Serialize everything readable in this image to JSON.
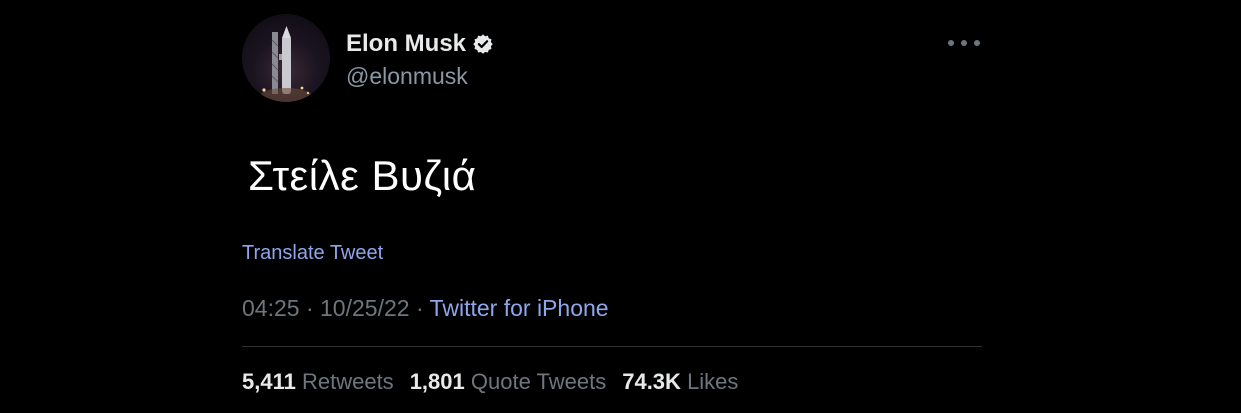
{
  "tweet": {
    "author": {
      "name": "Elon Musk",
      "handle": "@elonmusk",
      "verified_icon": "verified-badge-icon",
      "avatar_icon": "rocket-launchpad-avatar"
    },
    "more_icon": "more-options-icon",
    "text": "Στείλε Βυζιά",
    "translate_label": "Translate Tweet",
    "time": "04:25",
    "separator": "·",
    "date": "10/25/22",
    "source": "Twitter for iPhone",
    "stats": {
      "retweets_count": "5,411",
      "retweets_label": "Retweets",
      "quotes_count": "1,801",
      "quotes_label": "Quote Tweets",
      "likes_count": "74.3K",
      "likes_label": "Likes"
    }
  },
  "colors": {
    "background": "#000000",
    "link": "#8ea6ea",
    "secondary_text": "#6e767d",
    "primary_text": "#e7e9ea",
    "divider": "#2f3336"
  }
}
